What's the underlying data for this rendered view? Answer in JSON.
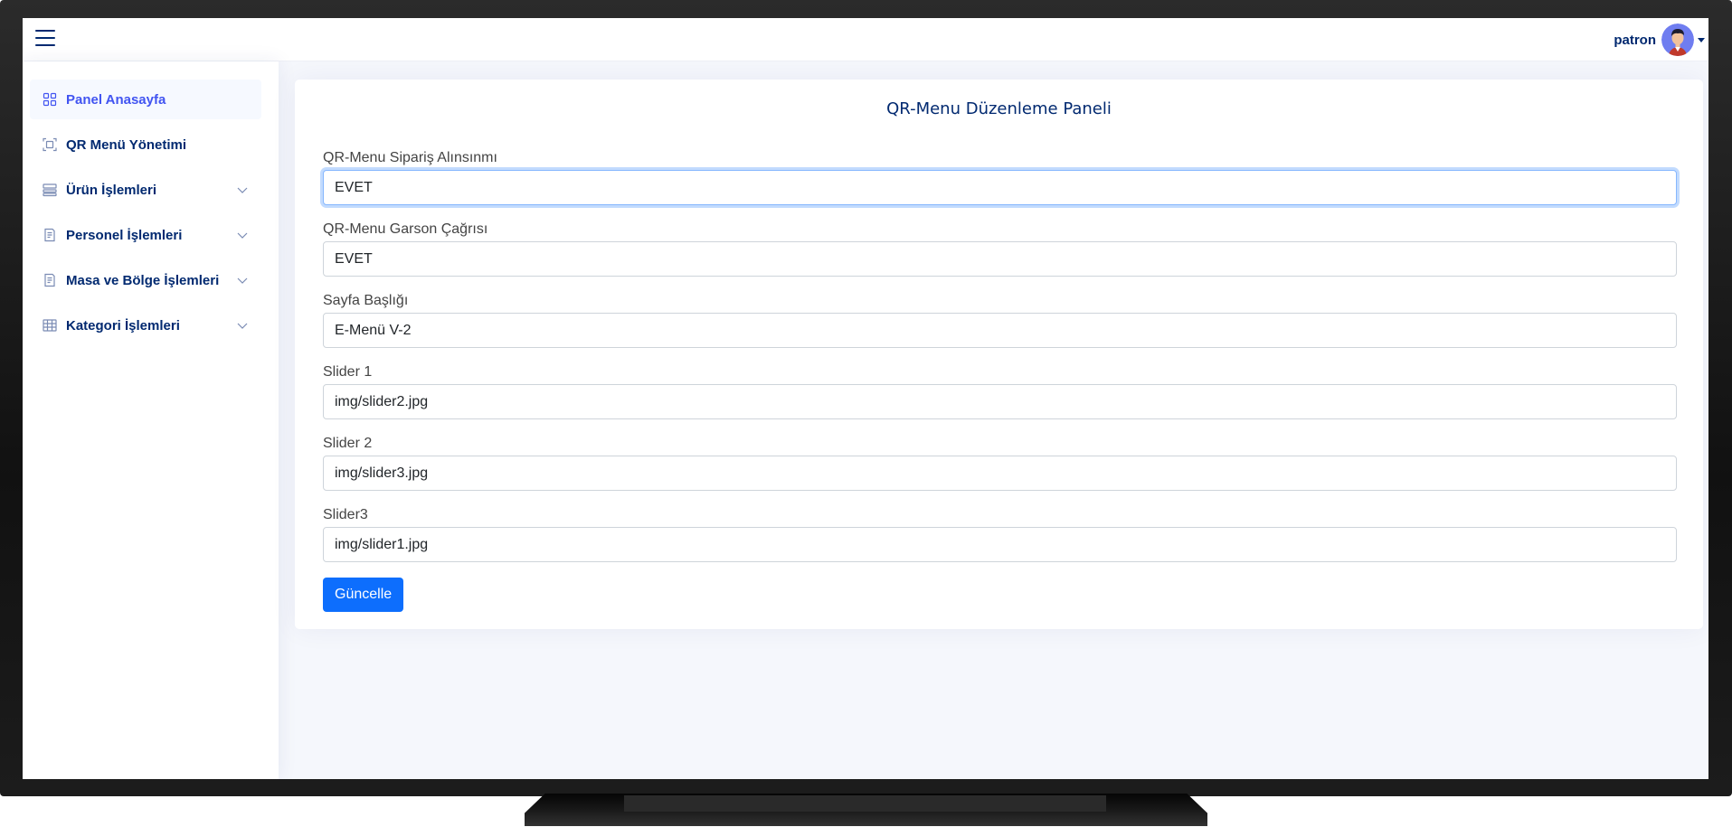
{
  "header": {
    "username": "patron"
  },
  "sidebar": {
    "items": [
      {
        "label": "Panel Anasayfa",
        "icon": "grid-icon",
        "active": true,
        "has_submenu": false
      },
      {
        "label": "QR Menü Yönetimi",
        "icon": "qr-scan-icon",
        "active": false,
        "has_submenu": false
      },
      {
        "label": "Ürün İşlemleri",
        "icon": "layout-list-icon",
        "active": false,
        "has_submenu": true
      },
      {
        "label": "Personel İşlemleri",
        "icon": "document-text-icon",
        "active": false,
        "has_submenu": true
      },
      {
        "label": "Masa ve Bölge İşlemleri",
        "icon": "document-text-icon",
        "active": false,
        "has_submenu": true
      },
      {
        "label": "Kategori İşlemleri",
        "icon": "table-icon",
        "active": false,
        "has_submenu": true
      }
    ]
  },
  "main": {
    "title": "QR-Menu Düzenleme Paneli",
    "fields": [
      {
        "label": "QR-Menu Sipariş Alınsınmı",
        "value": "EVET"
      },
      {
        "label": "QR-Menu Garson Çağrısı",
        "value": "EVET"
      },
      {
        "label": "Sayfa Başlığı",
        "value": "E-Menü V-2"
      },
      {
        "label": "Slider 1",
        "value": "img/slider2.jpg"
      },
      {
        "label": "Slider 2",
        "value": "img/slider3.jpg"
      },
      {
        "label": "Slider3",
        "value": "img/slider1.jpg"
      }
    ],
    "submit_label": "Güncelle"
  },
  "colors": {
    "brand": "#012970",
    "active": "#4154f1",
    "button": "#0d6efd",
    "background": "#f5f7fc"
  }
}
